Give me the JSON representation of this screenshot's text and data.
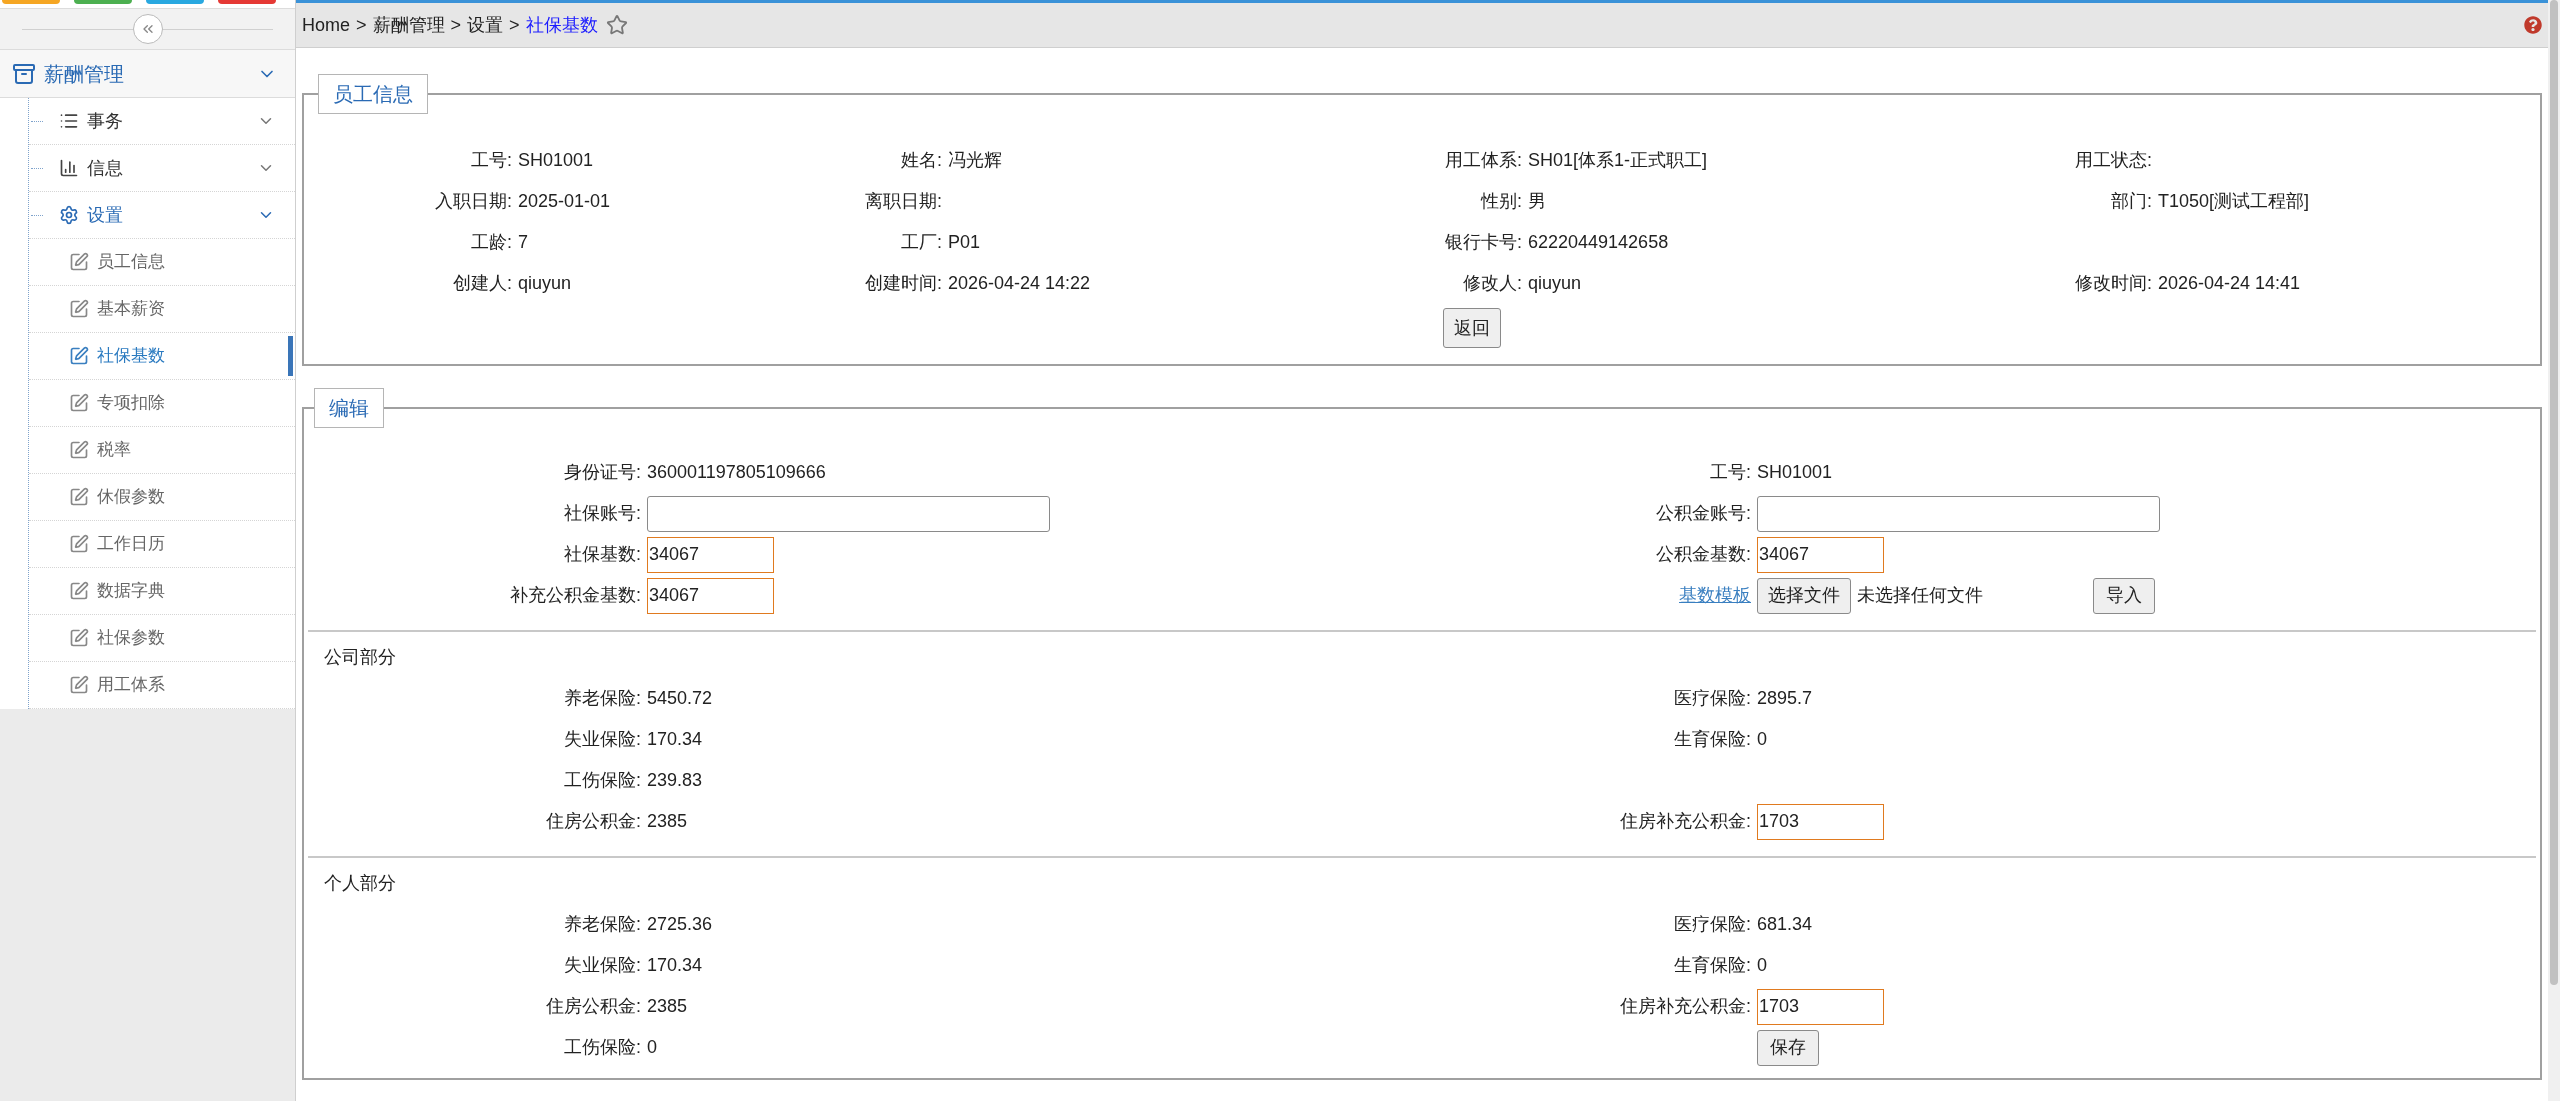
{
  "sidebar": {
    "top_buttons": [
      {
        "color": "#f5a623"
      },
      {
        "color": "#4caf50"
      },
      {
        "color": "#29a8e0"
      },
      {
        "color": "#e53935"
      }
    ],
    "menu": {
      "label": "薪酬管理",
      "expanded": true,
      "children": [
        {
          "label": "事务",
          "expanded": false
        },
        {
          "label": "信息",
          "expanded": false
        },
        {
          "label": "设置",
          "expanded": true,
          "children": [
            {
              "label": "员工信息",
              "selected": false
            },
            {
              "label": "基本薪资",
              "selected": false
            },
            {
              "label": "社保基数",
              "selected": true
            },
            {
              "label": "专项扣除",
              "selected": false
            },
            {
              "label": "税率",
              "selected": false
            },
            {
              "label": "休假参数",
              "selected": false
            },
            {
              "label": "工作日历",
              "selected": false
            },
            {
              "label": "数据字典",
              "selected": false
            },
            {
              "label": "社保参数",
              "selected": false
            },
            {
              "label": "用工体系",
              "selected": false
            }
          ]
        }
      ]
    }
  },
  "breadcrumb": {
    "separator": ">",
    "items": [
      {
        "label": "Home",
        "current": false
      },
      {
        "label": "薪酬管理",
        "current": false
      },
      {
        "label": "设置",
        "current": false
      },
      {
        "label": "社保基数",
        "current": true
      }
    ]
  },
  "employee_info": {
    "legend": "员工信息",
    "rows": [
      [
        {
          "label": "工号:",
          "value": "SH01001"
        },
        {
          "label": "姓名:",
          "value": "冯光辉"
        },
        {
          "label": "用工体系:",
          "value": "SH01[体系1-正式职工]"
        },
        {
          "label": "用工状态:"
        }
      ],
      [
        {
          "label": "入职日期:",
          "value": "2025-01-01"
        },
        {
          "label": "离职日期:"
        },
        {
          "label": "性别:",
          "value": "男"
        },
        {
          "label": "部门:",
          "value": "T1050[测试工程部]"
        }
      ],
      [
        {
          "label": "工龄:",
          "value": "7"
        },
        {
          "label": "工厂:",
          "value": "P01"
        },
        {
          "label": "银行卡号:",
          "value": "62220449142658"
        },
        null
      ],
      [
        {
          "label": "创建人:",
          "value": "qiuyun"
        },
        {
          "label": "创建时间:",
          "value": "2026-04-24 14:22"
        },
        {
          "label": "修改人:",
          "value": "qiuyun"
        },
        {
          "label": "修改时间:",
          "value": "2026-04-24 14:41"
        }
      ]
    ],
    "back_button": "返回"
  },
  "edit": {
    "legend": "编辑",
    "rows": [
      [
        {
          "kind": "text",
          "label": "身份证号:",
          "value": "360001197805109666"
        },
        {
          "kind": "text",
          "label": "工号:",
          "value": "SH01001"
        }
      ],
      [
        {
          "kind": "wide_input",
          "label": "社保账号:"
        },
        {
          "kind": "wide_input",
          "label": "公积金账号:"
        }
      ],
      [
        {
          "kind": "input",
          "label": "社保基数:",
          "value": "34067"
        },
        {
          "kind": "input",
          "label": "公积金基数:",
          "value": "34067"
        }
      ],
      [
        {
          "kind": "input",
          "label": "补充公积金基数:",
          "value": "34067"
        },
        {
          "kind": "file_import",
          "link": "基数模板",
          "file_button": "选择文件",
          "file_status": "未选择任何文件",
          "import_button": "导入"
        }
      ]
    ],
    "sections": [
      {
        "title": "公司部分",
        "rows": [
          [
            {
              "kind": "text",
              "label": "养老保险:",
              "value": "5450.72"
            },
            {
              "kind": "text",
              "label": "医疗保险:",
              "value": "2895.7"
            }
          ],
          [
            {
              "kind": "text",
              "label": "失业保险:",
              "value": "170.34"
            },
            {
              "kind": "text",
              "label": "生育保险:",
              "value": "0"
            }
          ],
          [
            {
              "kind": "text",
              "label": "工伤保险:",
              "value": "239.83"
            },
            null
          ],
          [
            {
              "kind": "text",
              "label": "住房公积金:",
              "value": "2385"
            },
            {
              "kind": "input",
              "label": "住房补充公积金:",
              "value": "1703"
            }
          ]
        ]
      },
      {
        "title": "个人部分",
        "rows": [
          [
            {
              "kind": "text",
              "label": "养老保险:",
              "value": "2725.36"
            },
            {
              "kind": "text",
              "label": "医疗保险:",
              "value": "681.34"
            }
          ],
          [
            {
              "kind": "text",
              "label": "失业保险:",
              "value": "170.34"
            },
            {
              "kind": "text",
              "label": "生育保险:",
              "value": "0"
            }
          ],
          [
            {
              "kind": "text",
              "label": "住房公积金:",
              "value": "2385"
            },
            {
              "kind": "input",
              "label": "住房补充公积金:",
              "value": "1703"
            }
          ],
          [
            {
              "kind": "text",
              "label": "工伤保险:",
              "value": "0"
            },
            {
              "kind": "button",
              "label": "保存"
            }
          ]
        ]
      }
    ]
  }
}
